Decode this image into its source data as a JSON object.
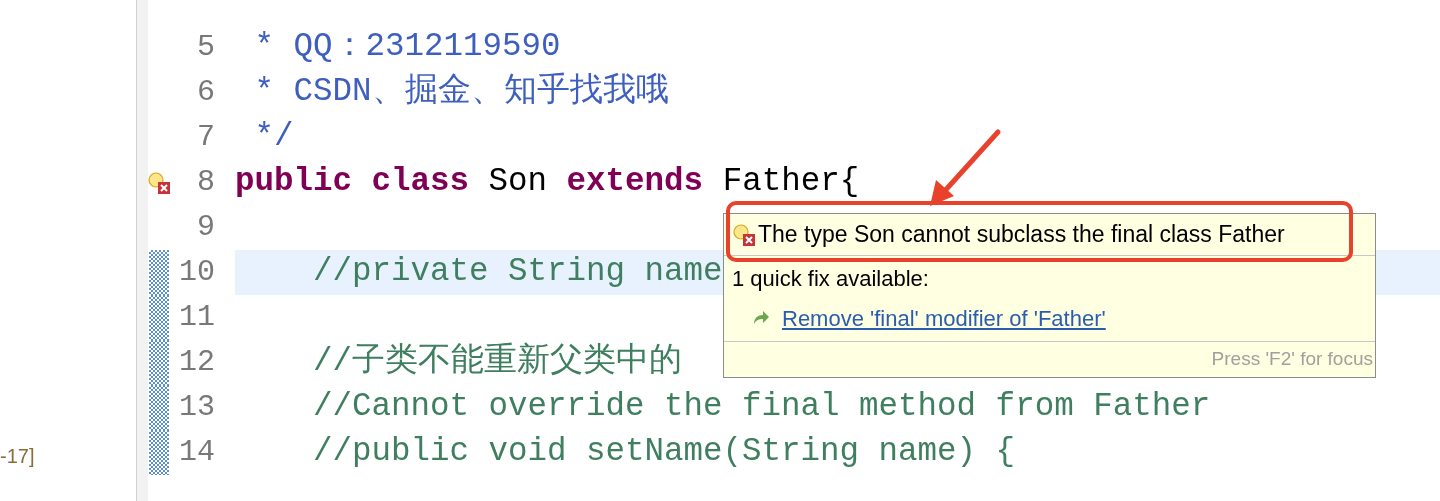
{
  "side_panel": {
    "text": "-17]"
  },
  "editor": {
    "lines": [
      {
        "number": "5",
        "changed": false,
        "current": false,
        "problem": false,
        "tokens": [
          {
            "kind": "doc",
            "text": " * QQ：2312119590"
          }
        ]
      },
      {
        "number": "6",
        "changed": false,
        "current": false,
        "problem": false,
        "tokens": [
          {
            "kind": "doc",
            "text": " * CSDN、掘金、知乎找我哦"
          }
        ]
      },
      {
        "number": "7",
        "changed": false,
        "current": false,
        "problem": false,
        "tokens": [
          {
            "kind": "doc",
            "text": " */"
          }
        ]
      },
      {
        "number": "8",
        "changed": false,
        "current": false,
        "problem": true,
        "tokens": [
          {
            "kind": "keyword",
            "text": "public"
          },
          {
            "kind": "keyword",
            "text": " class"
          },
          {
            "kind": "plain",
            "text": " Son "
          },
          {
            "kind": "keyword",
            "text": "extends"
          },
          {
            "kind": "plain",
            "text": " Father{"
          }
        ]
      },
      {
        "number": "9",
        "changed": false,
        "current": false,
        "problem": false
      },
      {
        "number": "10",
        "changed": true,
        "current": true,
        "problem": false,
        "tokens": [
          {
            "kind": "comment",
            "text": "    //private String name"
          }
        ]
      },
      {
        "number": "11",
        "changed": true,
        "current": false,
        "problem": false
      },
      {
        "number": "12",
        "changed": true,
        "current": false,
        "problem": false,
        "tokens": [
          {
            "kind": "comment",
            "text": "    //子类不能重新父类中的"
          }
        ]
      },
      {
        "number": "13",
        "changed": true,
        "current": false,
        "problem": false,
        "tokens": [
          {
            "kind": "comment",
            "text": "    //Cannot override the final method from Father"
          }
        ]
      },
      {
        "number": "14",
        "changed": true,
        "current": false,
        "problem": false,
        "tokens": [
          {
            "kind": "comment",
            "text": "    //public void setName(String name) {"
          }
        ]
      }
    ]
  },
  "hover": {
    "problem": "The type Son cannot subclass the final class Father",
    "summary": "1 quick fix available:",
    "fixes": [
      {
        "label": "Remove 'final' modifier of 'Father'"
      }
    ],
    "footer": "Press 'F2' for focus"
  }
}
